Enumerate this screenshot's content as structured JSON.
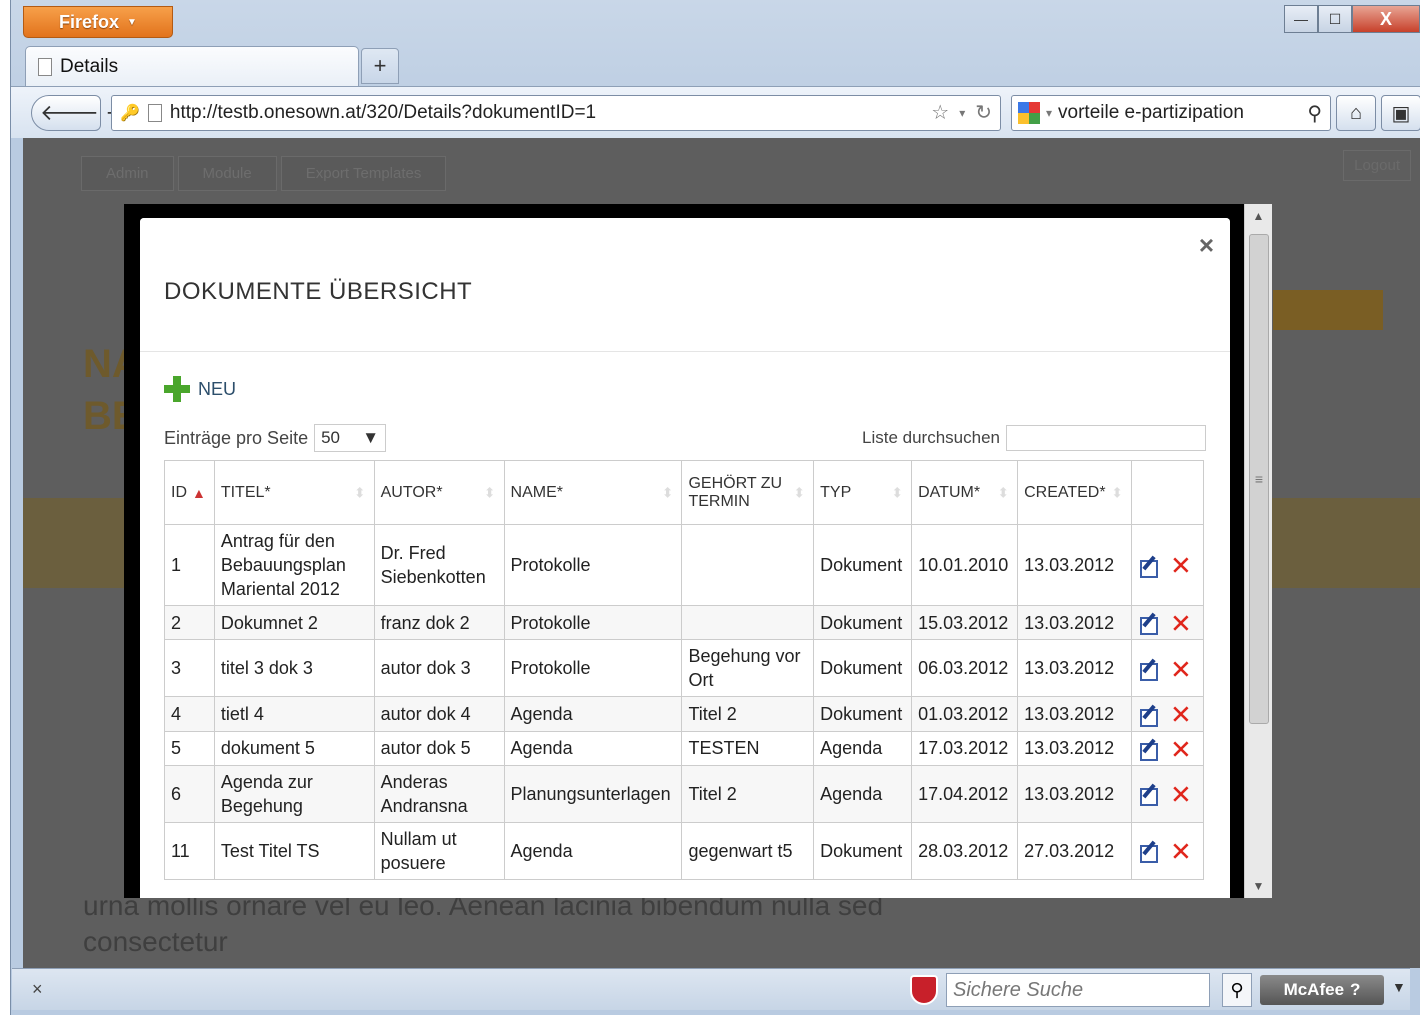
{
  "browser": {
    "app_button": "Firefox",
    "tab_title": "Details",
    "new_tab": "+",
    "url": "http://testb.onesown.at/320/Details?dokumentID=1",
    "search_engine_query": "vorteile e-partizipation",
    "window_controls": {
      "minimize": "—",
      "maximize": "☐",
      "close": "X"
    }
  },
  "background_page": {
    "nav_tabs": [
      "Admin",
      "Module",
      "Export Templates"
    ],
    "logout": "Logout",
    "big_text": "NA\nBE",
    "footer_text": "urna mollis ornare vel eu leo. Aenean lacinia bibendum nulla sed\nconsectetur"
  },
  "modal": {
    "title": "DOKUMENTE ÜBERSICHT",
    "close": "×",
    "new_label": "NEU",
    "per_page_label": "Einträge pro Seite",
    "per_page_value": "50",
    "search_label": "Liste durchsuchen",
    "columns": [
      "ID",
      "TITEL*",
      "AUTOR*",
      "NAME*",
      "GEHÖRT ZU TERMIN",
      "TYP",
      "DATUM*",
      "CREATED*",
      ""
    ],
    "rows": [
      [
        "1",
        "Antrag für den Bebauungsplan Mariental 2012",
        "Dr. Fred Siebenkotten",
        "Protokolle",
        "",
        "Dokument",
        "10.01.2010",
        "13.03.2012"
      ],
      [
        "2",
        "Dokumnet 2",
        "franz dok 2",
        "Protokolle",
        "",
        "Dokument",
        "15.03.2012",
        "13.03.2012"
      ],
      [
        "3",
        "titel 3 dok 3",
        "autor dok 3",
        "Protokolle",
        "Begehung vor Ort",
        "Dokument",
        "06.03.2012",
        "13.03.2012"
      ],
      [
        "4",
        "tietl 4",
        "autor dok 4",
        "Agenda",
        "Titel 2",
        "Dokument",
        "01.03.2012",
        "13.03.2012"
      ],
      [
        "5",
        "dokument 5",
        "autor dok 5",
        "Agenda",
        "TESTEN",
        "Agenda",
        "17.03.2012",
        "13.03.2012"
      ],
      [
        "6",
        "Agenda zur Begehung",
        "Anderas Andransna",
        "Planungsunterlagen",
        "Titel 2",
        "Agenda",
        "17.04.2012",
        "13.03.2012"
      ],
      [
        "11",
        "Test Titel TS",
        "Nullam ut posuere",
        "Agenda",
        "gegenwart t5",
        "Dokument",
        "28.03.2012",
        "27.03.2012"
      ]
    ]
  },
  "statusbar": {
    "close": "×",
    "safe_search_placeholder": "Sichere Suche",
    "mcafee": "McAfee"
  }
}
